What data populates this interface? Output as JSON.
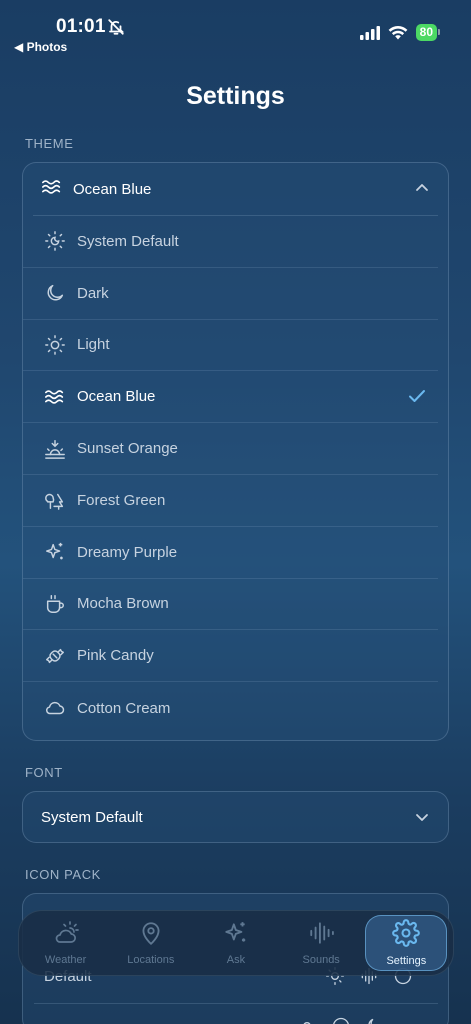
{
  "status_bar": {
    "time": "01:01",
    "back_app": "◀ Photos",
    "battery": "80"
  },
  "header": {
    "title": "Settings"
  },
  "theme": {
    "section_label": "THEME",
    "selected_label": "Ocean Blue",
    "items": [
      {
        "label": "System Default",
        "icon": "sun-moon-icon"
      },
      {
        "label": "Dark",
        "icon": "moon-icon"
      },
      {
        "label": "Light",
        "icon": "sun-icon"
      },
      {
        "label": "Ocean Blue",
        "icon": "waves-icon",
        "selected": true
      },
      {
        "label": "Sunset Orange",
        "icon": "sunset-icon"
      },
      {
        "label": "Forest Green",
        "icon": "trees-icon"
      },
      {
        "label": "Dreamy Purple",
        "icon": "sparkles-icon"
      },
      {
        "label": "Mocha Brown",
        "icon": "coffee-icon"
      },
      {
        "label": "Pink Candy",
        "icon": "candy-icon"
      },
      {
        "label": "Cotton Cream",
        "icon": "cloud-icon"
      }
    ]
  },
  "font": {
    "section_label": "FONT",
    "selected_label": "System Default"
  },
  "icon_pack": {
    "section_label": "ICON PACK",
    "row_label": "Default"
  },
  "tabs": [
    {
      "label": "Weather",
      "icon": "cloud-sun-icon"
    },
    {
      "label": "Locations",
      "icon": "map-pin-icon"
    },
    {
      "label": "Ask",
      "icon": "sparkles-icon"
    },
    {
      "label": "Sounds",
      "icon": "audio-waveform-icon"
    },
    {
      "label": "Settings",
      "icon": "gear-icon",
      "active": true
    }
  ],
  "colors": {
    "accent": "#6ab8ef",
    "battery": "#4cd964",
    "background": "#20476f"
  }
}
